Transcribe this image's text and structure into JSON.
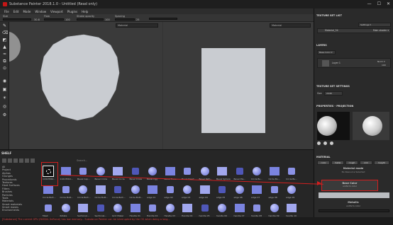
{
  "window": {
    "title": "Substance Painter 2018.1.0 - Untitled (Read only)",
    "controls": [
      "—",
      "☐",
      "✕"
    ]
  },
  "menu": [
    "File",
    "Edit",
    "Mode",
    "Window",
    "Viewport",
    "Plugins",
    "Help"
  ],
  "tool_options": {
    "size_label": "Size",
    "size_value": "30.6",
    "flow_label": "Flow",
    "flow_value": "100",
    "stroke_label": "Stroke opacity",
    "stroke_value": "100",
    "spacing_label": "Spacing",
    "spacing_value": "25"
  },
  "viewports": {
    "left_mode": "Material",
    "right_mode": "Material"
  },
  "shelf": {
    "title": "SHELF",
    "search_placeholder": "Search...",
    "categories": [
      "All",
      "Project",
      "Alphas",
      "Grunges",
      "Procedurals",
      "Textures",
      "Hard Surfaces",
      "Filters",
      "Brushes",
      "Particles",
      "Tools",
      "Materials",
      "Smart materials",
      "Smart masks",
      "Environments",
      "Color profiles"
    ],
    "row1_labels": [
      "1161356d...",
      "1161356d...",
      "Bevel Cap...",
      "Bevel Circle",
      "Bevel Circle",
      "Bevel Cross",
      "Bevel Egg",
      "Bevel Flow...",
      "Bevel Heart",
      "Bevel Path...",
      "Bevel Sphere",
      "Bevel Pla...",
      "Circle Bu...",
      "Circle Bu...",
      "Circle Bu..."
    ],
    "row2_labels": [
      "Circle Butt...",
      "Circle Butt...",
      "Circle Butt...",
      "Circle Butt...",
      "Circle Butt...",
      "Circle Butt...",
      "edge 01",
      "edge 02",
      "edge 03",
      "edge 04",
      "edge 05",
      "edge 06",
      "edge 07",
      "edge 08",
      "edge 09"
    ],
    "row3_labels": [
      "Mask",
      "Rotate",
      "Sectional...",
      "Sectional...",
      "Grid Maker",
      "Handle 01",
      "Handle 02",
      "Handle 03",
      "Handle 04",
      "handle 05",
      "handle 06",
      "handle 07",
      "handle 08",
      "handle 09",
      "handle 10"
    ]
  },
  "status": "[Substance] The current GPU (NVIDIA GeForce) has low memory...  Substance Painter can be interrupted by the OS when doing a long...",
  "right_panel": {
    "texture_set_list": {
      "title": "TEXTURE SET LIST",
      "settings": "Settings ▾",
      "item": "Material_34",
      "shader": "Main shader ▾"
    },
    "layers": {
      "title": "LAYERS",
      "channel": "Base Color ▾",
      "layer_name": "Layer 1",
      "blend": "Norm ▾",
      "opacity": "100"
    },
    "texture_set_settings": {
      "title": "TEXTURE SET SETTINGS",
      "size_label": "Size",
      "size_value": "2048"
    },
    "properties": {
      "title": "PROPERTIES - PROJECTION"
    },
    "material": {
      "title": "MATERIAL",
      "tags": [
        "color",
        "metal",
        "rough",
        "nrm",
        "height"
      ],
      "mode_label": "Material mode",
      "mode_value": "No Resource Selected",
      "base_color_label": "Base Color",
      "base_color_value": "uniform color",
      "metallic_label": "Metallic",
      "metallic_value": "uniform color"
    }
  },
  "colors": {
    "accent_red": "#d21f1f",
    "highlight_blue": "#3d6fb0",
    "mesh_gray": "#c9ccd1"
  }
}
